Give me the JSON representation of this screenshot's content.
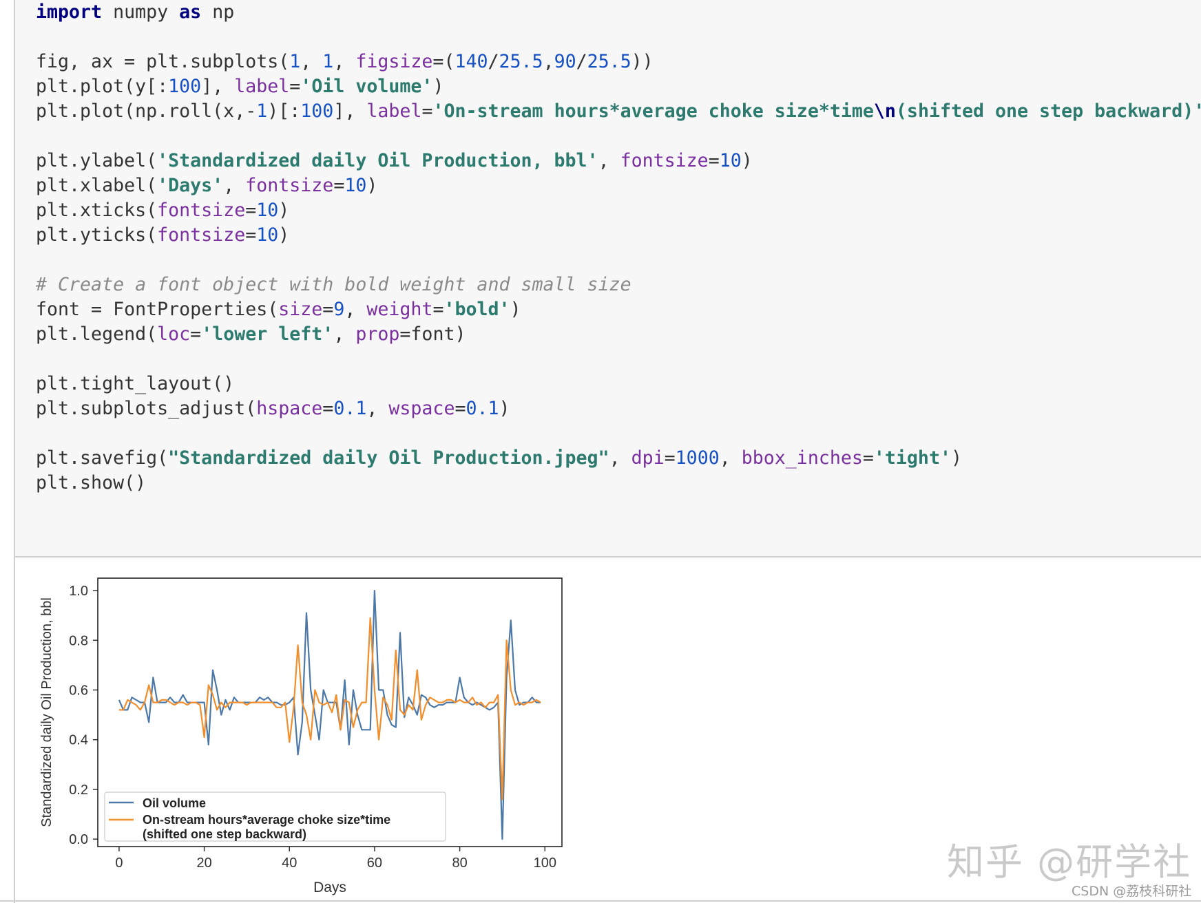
{
  "code_lines": [
    [
      {
        "t": "import",
        "c": "kw"
      },
      {
        "t": " numpy "
      },
      {
        "t": "as",
        "c": "kw"
      },
      {
        "t": " np"
      }
    ],
    [],
    [
      {
        "t": "fig, ax = plt.subplots("
      },
      {
        "t": "1",
        "c": "num"
      },
      {
        "t": ", "
      },
      {
        "t": "1",
        "c": "num"
      },
      {
        "t": ", "
      },
      {
        "t": "figsize",
        "c": "param"
      },
      {
        "t": "=("
      },
      {
        "t": "140",
        "c": "num"
      },
      {
        "t": "/"
      },
      {
        "t": "25.5",
        "c": "num"
      },
      {
        "t": ","
      },
      {
        "t": "90",
        "c": "num"
      },
      {
        "t": "/"
      },
      {
        "t": "25.5",
        "c": "num"
      },
      {
        "t": "))"
      }
    ],
    [
      {
        "t": "plt.plot(y[:"
      },
      {
        "t": "100",
        "c": "num"
      },
      {
        "t": "], "
      },
      {
        "t": "label",
        "c": "param"
      },
      {
        "t": "="
      },
      {
        "t": "'Oil volume'",
        "c": "str"
      },
      {
        "t": ")"
      }
    ],
    [
      {
        "t": "plt.plot(np.roll(x,-"
      },
      {
        "t": "1",
        "c": "num"
      },
      {
        "t": ")[:"
      },
      {
        "t": "100",
        "c": "num"
      },
      {
        "t": "], "
      },
      {
        "t": "label",
        "c": "param"
      },
      {
        "t": "="
      },
      {
        "t": "'On-stream hours*average choke size*time",
        "c": "str"
      },
      {
        "t": "\\n",
        "c": "esc"
      },
      {
        "t": "(shifted one step backward)'",
        "c": "str"
      },
      {
        "t": ")"
      }
    ],
    [],
    [
      {
        "t": "plt.ylabel("
      },
      {
        "t": "'Standardized daily Oil Production, bbl'",
        "c": "str"
      },
      {
        "t": ", "
      },
      {
        "t": "fontsize",
        "c": "param"
      },
      {
        "t": "="
      },
      {
        "t": "10",
        "c": "num"
      },
      {
        "t": ")"
      }
    ],
    [
      {
        "t": "plt.xlabel("
      },
      {
        "t": "'Days'",
        "c": "str"
      },
      {
        "t": ", "
      },
      {
        "t": "fontsize",
        "c": "param"
      },
      {
        "t": "="
      },
      {
        "t": "10",
        "c": "num"
      },
      {
        "t": ")"
      }
    ],
    [
      {
        "t": "plt.xticks("
      },
      {
        "t": "fontsize",
        "c": "param"
      },
      {
        "t": "="
      },
      {
        "t": "10",
        "c": "num"
      },
      {
        "t": ")"
      }
    ],
    [
      {
        "t": "plt.yticks("
      },
      {
        "t": "fontsize",
        "c": "param"
      },
      {
        "t": "="
      },
      {
        "t": "10",
        "c": "num"
      },
      {
        "t": ")"
      }
    ],
    [],
    [
      {
        "t": "# Create a font object with bold weight and small size",
        "c": "cmt"
      }
    ],
    [
      {
        "t": "font = FontProperties("
      },
      {
        "t": "size",
        "c": "param"
      },
      {
        "t": "="
      },
      {
        "t": "9",
        "c": "num"
      },
      {
        "t": ", "
      },
      {
        "t": "weight",
        "c": "param"
      },
      {
        "t": "="
      },
      {
        "t": "'bold'",
        "c": "str"
      },
      {
        "t": ")"
      }
    ],
    [
      {
        "t": "plt.legend("
      },
      {
        "t": "loc",
        "c": "param"
      },
      {
        "t": "="
      },
      {
        "t": "'lower left'",
        "c": "str"
      },
      {
        "t": ", "
      },
      {
        "t": "prop",
        "c": "param"
      },
      {
        "t": "=font)"
      }
    ],
    [],
    [
      {
        "t": "plt.tight_layout()"
      }
    ],
    [
      {
        "t": "plt.subplots_adjust("
      },
      {
        "t": "hspace",
        "c": "param"
      },
      {
        "t": "="
      },
      {
        "t": "0.1",
        "c": "num"
      },
      {
        "t": ", "
      },
      {
        "t": "wspace",
        "c": "param"
      },
      {
        "t": "="
      },
      {
        "t": "0.1",
        "c": "num"
      },
      {
        "t": ")"
      }
    ],
    [],
    [
      {
        "t": "plt.savefig("
      },
      {
        "t": "\"Standardized daily Oil Production.jpeg\"",
        "c": "str"
      },
      {
        "t": ", "
      },
      {
        "t": "dpi",
        "c": "param"
      },
      {
        "t": "="
      },
      {
        "t": "1000",
        "c": "num"
      },
      {
        "t": ", "
      },
      {
        "t": "bbox_inches",
        "c": "param"
      },
      {
        "t": "="
      },
      {
        "t": "'tight'",
        "c": "str"
      },
      {
        "t": ")"
      }
    ],
    [
      {
        "t": "plt.show()"
      }
    ]
  ],
  "chart_data": {
    "type": "line",
    "xlabel": "Days",
    "ylabel": "Standardized daily Oil Production, bbl",
    "xlim": [
      -5,
      104
    ],
    "ylim": [
      -0.03,
      1.05
    ],
    "xticks": [
      0,
      20,
      40,
      60,
      80,
      100
    ],
    "yticks": [
      0.0,
      0.2,
      0.4,
      0.6,
      0.8,
      1.0
    ],
    "ytick_labels": [
      "0.0",
      "0.2",
      "0.4",
      "0.6",
      "0.8",
      "1.0"
    ],
    "grid": false,
    "legend_position": "lower left",
    "series": [
      {
        "name": "Oil volume",
        "color": "#4c78a8",
        "values": [
          0.56,
          0.52,
          0.52,
          0.57,
          0.56,
          0.55,
          0.55,
          0.47,
          0.65,
          0.55,
          0.55,
          0.55,
          0.57,
          0.55,
          0.55,
          0.58,
          0.55,
          0.55,
          0.55,
          0.55,
          0.55,
          0.38,
          0.68,
          0.6,
          0.5,
          0.56,
          0.52,
          0.57,
          0.55,
          0.55,
          0.55,
          0.55,
          0.55,
          0.57,
          0.56,
          0.57,
          0.55,
          0.55,
          0.54,
          0.54,
          0.55,
          0.57,
          0.34,
          0.47,
          0.91,
          0.6,
          0.5,
          0.4,
          0.6,
          0.55,
          0.55,
          0.55,
          0.44,
          0.64,
          0.38,
          0.6,
          0.5,
          0.44,
          0.44,
          0.44,
          1.0,
          0.6,
          0.6,
          0.5,
          0.46,
          0.45,
          0.83,
          0.49,
          0.57,
          0.54,
          0.5,
          0.58,
          0.57,
          0.54,
          0.53,
          0.54,
          0.54,
          0.55,
          0.55,
          0.55,
          0.65,
          0.57,
          0.55,
          0.54,
          0.55,
          0.54,
          0.53,
          0.52,
          0.53,
          0.55,
          0.0,
          0.65,
          0.88,
          0.6,
          0.54,
          0.55,
          0.55,
          0.57,
          0.55,
          0.55
        ]
      },
      {
        "name": "On-stream hours*average choke size*time\n(shifted one step backward)",
        "color": "#f28e2b",
        "values": [
          0.52,
          0.52,
          0.56,
          0.55,
          0.54,
          0.52,
          0.55,
          0.62,
          0.55,
          0.55,
          0.56,
          0.56,
          0.55,
          0.54,
          0.55,
          0.55,
          0.54,
          0.55,
          0.55,
          0.54,
          0.41,
          0.62,
          0.58,
          0.52,
          0.55,
          0.53,
          0.55,
          0.55,
          0.55,
          0.55,
          0.54,
          0.55,
          0.55,
          0.55,
          0.55,
          0.55,
          0.55,
          0.53,
          0.53,
          0.55,
          0.39,
          0.53,
          0.78,
          0.55,
          0.5,
          0.4,
          0.6,
          0.55,
          0.54,
          0.55,
          0.51,
          0.58,
          0.44,
          0.56,
          0.55,
          0.45,
          0.52,
          0.55,
          0.55,
          0.89,
          0.6,
          0.4,
          0.57,
          0.54,
          0.48,
          0.76,
          0.52,
          0.5,
          0.54,
          0.52,
          0.68,
          0.48,
          0.54,
          0.57,
          0.56,
          0.55,
          0.55,
          0.56,
          0.56,
          0.55,
          0.56,
          0.55,
          0.55,
          0.57,
          0.54,
          0.55,
          0.53,
          0.55,
          0.55,
          0.58,
          0.16,
          0.8,
          0.6,
          0.54,
          0.55,
          0.54,
          0.55,
          0.55,
          0.56,
          0.55
        ]
      }
    ]
  },
  "watermark": {
    "main": "知乎 @研学社",
    "small": "CSDN @荔枝科研社"
  }
}
